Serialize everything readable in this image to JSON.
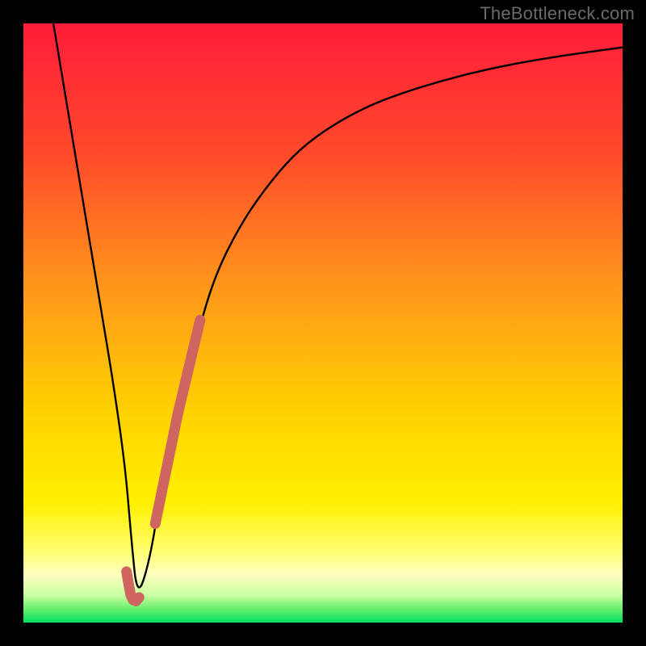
{
  "watermark": "TheBottleneck.com",
  "colors": {
    "frame": "#000000",
    "watermark": "#6a6a6a",
    "curve": "#000000",
    "marker": "#cf6560",
    "gradient_top": "#ff1c3a",
    "gradient_mid_orange": "#ff7a1f",
    "gradient_mid_yellow": "#fff000",
    "gradient_light_yellow": "#ffffa0",
    "gradient_green": "#00e060"
  },
  "chart_data": {
    "type": "line",
    "title": "",
    "xlabel": "",
    "ylabel": "",
    "xlim": [
      0,
      100
    ],
    "ylim": [
      0,
      100
    ],
    "series": [
      {
        "name": "bottleneck-curve",
        "x": [
          5,
          7,
          9,
          11,
          13,
          15,
          17,
          18,
          19,
          21,
          23,
          26,
          29,
          32,
          36,
          40,
          45,
          50,
          56,
          62,
          70,
          78,
          86,
          94,
          100
        ],
        "y": [
          100,
          88,
          76,
          64,
          52,
          40,
          26,
          14,
          4,
          10,
          22,
          36,
          48,
          58,
          66,
          72,
          78,
          82,
          85.5,
          88,
          90.5,
          92.5,
          94,
          95.2,
          96
        ]
      }
    ],
    "markers": [
      {
        "name": "marker-hook",
        "x": [
          17.2,
          17.6,
          17.9,
          18.3,
          18.8,
          19.3
        ],
        "y": [
          8.5,
          6.2,
          4.6,
          3.8,
          3.6,
          4.2
        ]
      },
      {
        "name": "marker-slope",
        "x": [
          22.0,
          25.8,
          29.5
        ],
        "y": [
          16.5,
          35.0,
          50.5
        ]
      }
    ]
  }
}
